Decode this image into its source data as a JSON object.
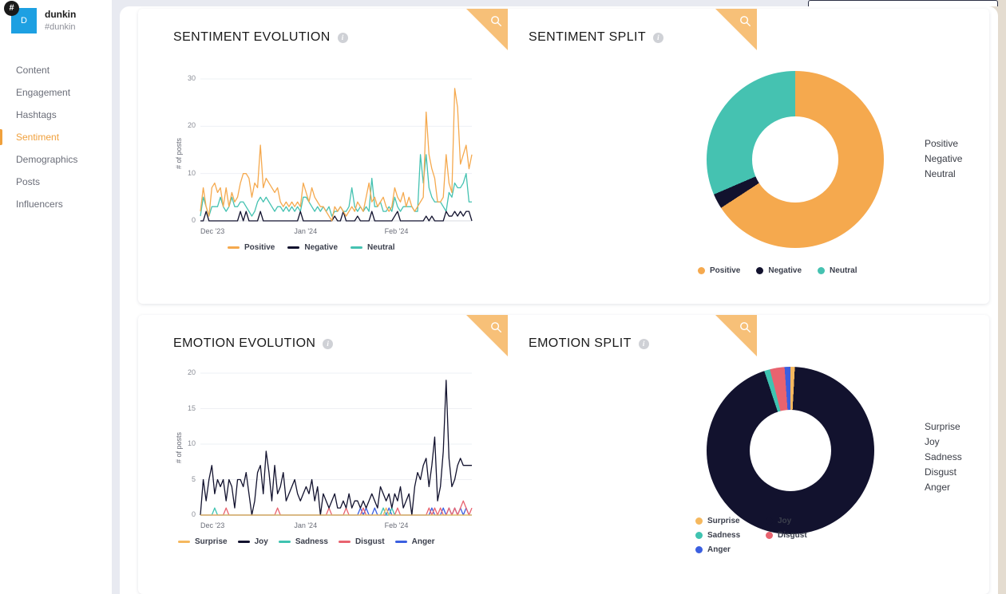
{
  "sidebar": {
    "account_initial": "D",
    "account_name": "dunkin",
    "account_handle": "#dunkin",
    "hash_badge": "#",
    "items": [
      {
        "label": "Content",
        "active": false
      },
      {
        "label": "Engagement",
        "active": false
      },
      {
        "label": "Hashtags",
        "active": false
      },
      {
        "label": "Sentiment",
        "active": true
      },
      {
        "label": "Demographics",
        "active": false
      },
      {
        "label": "Posts",
        "active": false
      },
      {
        "label": "Influencers",
        "active": false
      }
    ]
  },
  "cards": {
    "sentiment_evolution": {
      "title": "SENTIMENT EVOLUTION",
      "info": "i",
      "search": "search-icon"
    },
    "sentiment_split": {
      "title": "SENTIMENT SPLIT",
      "info": "i",
      "search": "search-icon"
    },
    "emotion_evolution": {
      "title": "EMOTION EVOLUTION",
      "info": "i",
      "search": "search-icon"
    },
    "emotion_split": {
      "title": "EMOTION SPLIT",
      "info": "i",
      "search": "search-icon"
    }
  },
  "colors": {
    "positive": "#f5a94e",
    "negative": "#12122e",
    "neutral": "#45c2b1",
    "surprise": "#f5b85e",
    "joy": "#12122e",
    "sadness": "#3fc3b0",
    "disgust": "#e8636f",
    "anger": "#3b5fe0",
    "accent": "#f0a03c",
    "ribbon": "#f7c078"
  },
  "chart_data": [
    {
      "id": "sentiment_evolution",
      "type": "line",
      "title": "SENTIMENT EVOLUTION",
      "xlabel": "",
      "ylabel": "# of posts",
      "ylim": [
        0,
        30
      ],
      "yticks": [
        0,
        10,
        20,
        30
      ],
      "xticks": [
        "Dec '23",
        "Jan '24",
        "Feb '24"
      ],
      "grid": true,
      "legend_position": "bottom",
      "series": [
        {
          "name": "Positive",
          "color": "#f5a94e",
          "values": [
            2,
            7,
            3,
            1,
            7,
            8,
            6,
            7,
            3,
            7,
            3,
            6,
            4,
            5,
            8,
            10,
            10,
            9,
            5,
            8,
            7,
            16,
            7,
            9,
            8,
            7,
            6,
            7,
            4,
            3,
            4,
            3,
            4,
            3,
            4,
            3,
            8,
            6,
            4,
            7,
            5,
            4,
            3,
            3,
            2,
            1,
            0,
            3,
            2,
            3,
            2,
            1,
            2,
            3,
            2,
            4,
            3,
            2,
            5,
            8,
            4,
            5,
            3,
            4,
            5,
            3,
            2,
            3,
            7,
            5,
            4,
            6,
            3,
            5,
            3,
            2,
            3,
            4,
            5,
            23,
            14,
            11,
            9,
            4,
            4,
            5,
            14,
            8,
            6,
            28,
            24,
            12,
            14,
            16,
            11,
            14
          ]
        },
        {
          "name": "Negative",
          "color": "#12122e",
          "values": [
            0,
            0,
            2,
            0,
            0,
            0,
            0,
            0,
            0,
            0,
            0,
            0,
            0,
            0,
            2,
            0,
            2,
            0,
            0,
            0,
            0,
            2,
            0,
            0,
            0,
            0,
            0,
            0,
            0,
            0,
            0,
            0,
            0,
            0,
            0,
            2,
            0,
            0,
            0,
            0,
            0,
            0,
            0,
            0,
            0,
            0,
            0,
            1,
            0,
            0,
            2,
            0,
            0,
            0,
            0,
            1,
            0,
            0,
            0,
            0,
            2,
            0,
            0,
            0,
            0,
            0,
            0,
            0,
            1,
            2,
            0,
            0,
            0,
            0,
            0,
            0,
            0,
            0,
            0,
            1,
            0,
            1,
            0,
            0,
            0,
            0,
            2,
            1,
            1,
            2,
            1,
            2,
            1,
            2,
            2,
            0
          ]
        },
        {
          "name": "Neutral",
          "color": "#45c2b1",
          "values": [
            1,
            5,
            3,
            1,
            3,
            3,
            3,
            5,
            3,
            2,
            3,
            5,
            3,
            3,
            4,
            4,
            3,
            2,
            1,
            2,
            4,
            5,
            4,
            5,
            4,
            3,
            2,
            3,
            3,
            2,
            3,
            2,
            3,
            2,
            3,
            2,
            5,
            5,
            4,
            3,
            2,
            3,
            2,
            3,
            2,
            3,
            1,
            2,
            2,
            3,
            2,
            2,
            3,
            7,
            3,
            2,
            3,
            2,
            3,
            2,
            9,
            3,
            3,
            4,
            2,
            2,
            3,
            2,
            5,
            3,
            2,
            3,
            3,
            3,
            3,
            2,
            2,
            14,
            8,
            14,
            7,
            5,
            4,
            4,
            4,
            3,
            2,
            6,
            5,
            8,
            7,
            7,
            8,
            10,
            4,
            4
          ]
        }
      ]
    },
    {
      "id": "sentiment_split",
      "type": "pie",
      "title": "SENTIMENT SPLIT",
      "legend_position": "bottom",
      "labels": [
        "Positive",
        "Negative",
        "Neutral"
      ],
      "values": [
        600,
        25,
        287
      ],
      "colors": [
        "#f5a94e",
        "#12122e",
        "#45c2b1"
      ]
    },
    {
      "id": "emotion_evolution",
      "type": "line",
      "title": "EMOTION EVOLUTION",
      "xlabel": "",
      "ylabel": "# of posts",
      "ylim": [
        0,
        20
      ],
      "yticks": [
        0,
        5,
        10,
        15,
        20
      ],
      "xticks": [
        "Dec '23",
        "Jan '24",
        "Feb '24"
      ],
      "grid": true,
      "legend_position": "bottom",
      "series": [
        {
          "name": "Surprise",
          "color": "#f5b85e",
          "values": [
            0,
            0,
            0,
            0,
            0,
            0,
            0,
            0,
            0,
            0,
            0,
            0,
            0,
            0,
            0,
            0,
            0,
            0,
            0,
            0,
            0,
            0,
            0,
            0,
            0,
            0,
            0,
            0,
            0,
            0,
            0,
            0,
            0,
            0,
            0,
            0,
            0,
            0,
            0,
            0,
            0,
            0,
            0,
            0,
            0,
            0,
            0,
            0,
            0,
            0,
            0,
            0,
            0,
            0,
            0,
            0,
            0,
            0,
            0,
            0,
            0,
            0,
            0,
            0,
            0,
            1,
            0,
            0,
            0,
            0,
            0,
            0,
            0,
            0,
            0,
            0,
            0,
            0,
            0,
            0,
            0,
            0,
            0,
            0,
            0,
            0,
            0,
            0,
            0,
            0,
            0,
            0,
            0,
            0,
            0,
            0
          ]
        },
        {
          "name": "Joy",
          "color": "#12122e",
          "values": [
            0,
            5,
            2,
            5,
            7,
            3,
            5,
            4,
            5,
            2,
            5,
            4,
            1,
            5,
            5,
            4,
            6,
            3,
            0,
            2,
            6,
            7,
            3,
            9,
            6,
            2,
            7,
            3,
            4,
            6,
            2,
            3,
            4,
            5,
            3,
            2,
            3,
            4,
            3,
            5,
            2,
            4,
            0,
            3,
            2,
            1,
            2,
            3,
            1,
            1,
            2,
            1,
            3,
            1,
            2,
            2,
            1,
            2,
            1,
            2,
            3,
            2,
            1,
            4,
            3,
            2,
            3,
            1,
            3,
            2,
            4,
            1,
            2,
            3,
            0,
            4,
            6,
            5,
            7,
            8,
            4,
            7,
            11,
            2,
            4,
            9,
            19,
            8,
            4,
            5,
            7,
            8,
            7,
            7,
            7,
            7
          ]
        },
        {
          "name": "Sadness",
          "color": "#3fc3b0",
          "values": [
            0,
            0,
            0,
            0,
            0,
            1,
            0,
            0,
            0,
            0,
            0,
            0,
            0,
            0,
            0,
            0,
            0,
            0,
            0,
            0,
            0,
            0,
            0,
            0,
            0,
            0,
            0,
            0,
            0,
            0,
            0,
            0,
            0,
            0,
            0,
            0,
            0,
            0,
            0,
            0,
            0,
            0,
            0,
            0,
            0,
            0,
            0,
            0,
            0,
            0,
            0,
            0,
            0,
            0,
            0,
            0,
            0,
            0,
            0,
            0,
            0,
            0,
            0,
            0,
            1,
            0,
            0,
            1,
            0,
            0,
            0,
            0,
            0,
            0,
            0,
            0,
            0,
            0,
            0,
            0,
            0,
            0,
            0,
            0,
            0,
            0,
            0,
            0,
            0,
            0,
            0,
            0,
            0,
            0,
            0,
            0
          ]
        },
        {
          "name": "Disgust",
          "color": "#e8636f",
          "values": [
            0,
            0,
            0,
            0,
            0,
            0,
            0,
            0,
            0,
            1,
            0,
            0,
            0,
            0,
            0,
            0,
            0,
            0,
            0,
            0,
            0,
            0,
            0,
            0,
            0,
            0,
            0,
            1,
            0,
            0,
            0,
            0,
            0,
            0,
            0,
            0,
            0,
            0,
            0,
            0,
            0,
            0,
            0,
            0,
            0,
            1,
            0,
            0,
            0,
            0,
            0,
            1,
            0,
            0,
            0,
            0,
            0,
            1,
            0,
            0,
            0,
            0,
            0,
            0,
            0,
            0,
            0,
            0,
            0,
            1,
            0,
            0,
            0,
            0,
            0,
            0,
            0,
            0,
            0,
            0,
            1,
            0,
            1,
            0,
            1,
            0,
            0,
            1,
            0,
            1,
            0,
            1,
            2,
            1,
            0,
            1
          ]
        },
        {
          "name": "Anger",
          "color": "#3b5fe0",
          "values": [
            0,
            0,
            0,
            0,
            0,
            0,
            0,
            0,
            0,
            0,
            0,
            0,
            0,
            0,
            0,
            0,
            0,
            0,
            0,
            0,
            0,
            0,
            0,
            0,
            0,
            0,
            0,
            0,
            0,
            0,
            0,
            0,
            0,
            0,
            0,
            0,
            0,
            0,
            0,
            0,
            0,
            0,
            0,
            0,
            0,
            0,
            0,
            0,
            0,
            0,
            0,
            0,
            0,
            0,
            0,
            0,
            1,
            0,
            1,
            0,
            0,
            1,
            0,
            0,
            0,
            0,
            1,
            0,
            0,
            0,
            0,
            0,
            0,
            0,
            0,
            0,
            0,
            0,
            0,
            0,
            0,
            1,
            0,
            0,
            0,
            1,
            0,
            1,
            0,
            1,
            0,
            1,
            0,
            1,
            0,
            0
          ]
        }
      ]
    },
    {
      "id": "emotion_split",
      "type": "pie",
      "title": "EMOTION SPLIT",
      "legend_position": "bottom",
      "labels": [
        "Surprise",
        "Joy",
        "Sadness",
        "Disgust",
        "Anger"
      ],
      "values": [
        3,
        335,
        4,
        10,
        4
      ],
      "colors": [
        "#f5b85e",
        "#12122e",
        "#3fc3b0",
        "#e8636f",
        "#3b5fe0"
      ]
    }
  ]
}
